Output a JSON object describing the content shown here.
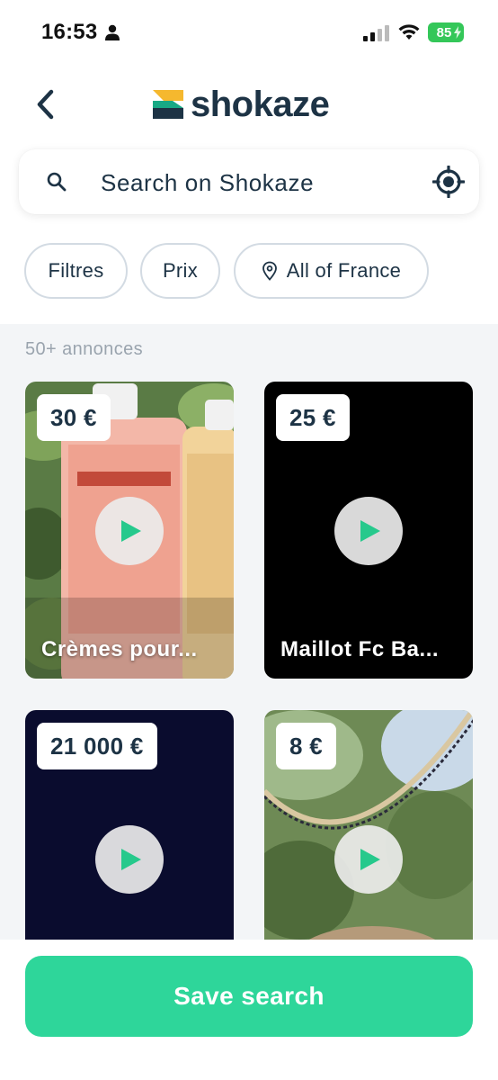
{
  "status_bar": {
    "time": "16:53",
    "battery": "85"
  },
  "header": {
    "logo_text": "shokaze",
    "back_icon": "chevron-left-icon"
  },
  "search": {
    "placeholder": "Search on Shokaze",
    "icon": "search-icon",
    "locate_icon": "location-target-icon"
  },
  "filters": {
    "chips": [
      {
        "label": "Filtres"
      },
      {
        "label": "Prix"
      },
      {
        "label": "All of France",
        "icon": "pin-icon"
      }
    ]
  },
  "results": {
    "count_label": "50+ annonces",
    "listings": [
      {
        "price": "30 €",
        "title": "Crèmes pour..."
      },
      {
        "price": "25 €",
        "title": "Maillot Fc Ba..."
      },
      {
        "price": "21 000 €",
        "title": ""
      },
      {
        "price": "8 €",
        "title": ""
      }
    ]
  },
  "actions": {
    "save_search_label": "Save search"
  },
  "colors": {
    "accent": "#2ed69a",
    "text_dark": "#1d3345",
    "logo_yellow": "#f5b82e",
    "logo_teal": "#18a985",
    "play_green": "#26c98c"
  }
}
